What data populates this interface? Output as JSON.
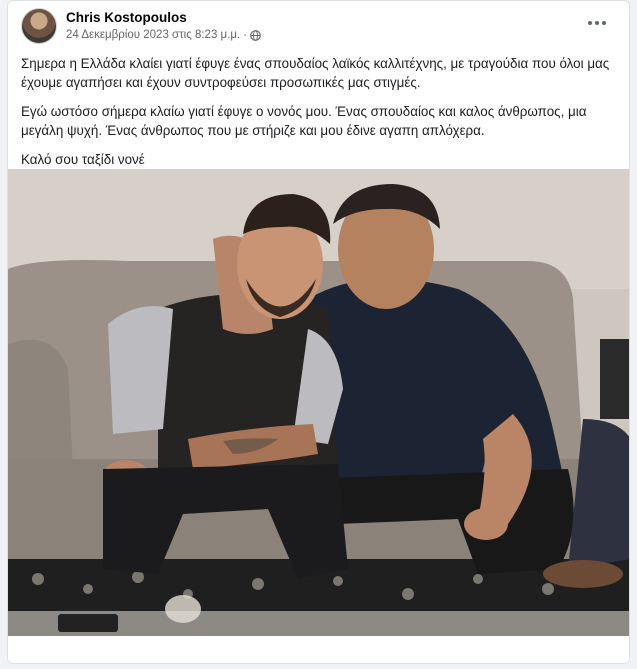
{
  "post": {
    "author": "Chris Kostopoulos",
    "timestamp": "24 Δεκεμβρίου 2023 στις 8:23 μ.μ.",
    "separator": "·",
    "privacy_icon": "globe-icon",
    "more_icon": "more-horizontal-icon",
    "paragraphs": [
      "Σημερα η Ελλάδα κλαίει γιατί έφυγε ένας σπουδαίος λαϊκός καλλιτέχνης, με τραγούδια που όλοι μας έχουμε αγαπήσει και έχουν συντροφεύσει προσωπικές μας στιγμές.",
      "Εγώ ωστόσο σήμερα κλαίω γιατί έφυγε ο νονός μου. Ένας σπουδαίος και καλος άνθρωπος, μια μεγάλη ψυχή. Ένας άνθρωπος που με στήριζε και μου έδινε αγαπη απλόχερα.",
      "Καλό σου ταξίδι νονέ"
    ]
  },
  "colors": {
    "page_background": "#f0f2f5",
    "card_background": "#ffffff",
    "author_text": "#050505",
    "meta_text": "#65676b",
    "body_text": "#1c1e21"
  }
}
